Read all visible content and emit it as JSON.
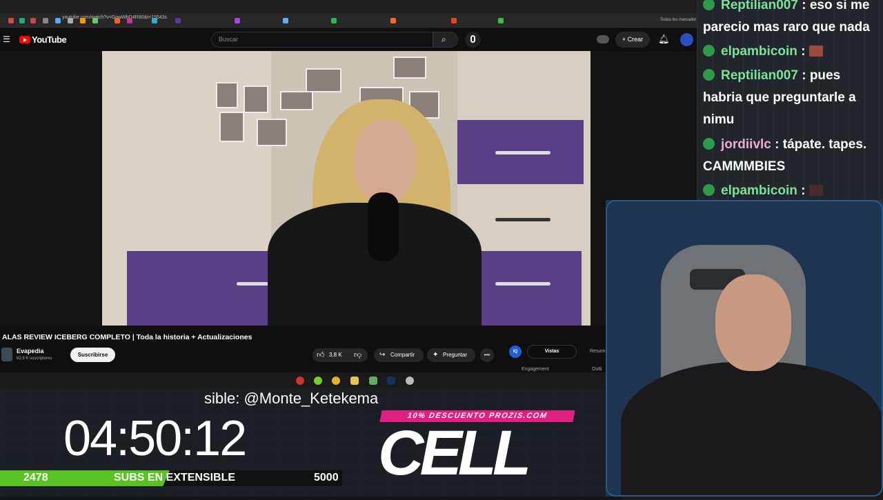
{
  "browser": {
    "url": "youtube.com/watch?v=GgwWbD4R80&t=15543s",
    "bookmarks_label": "Todos los marcador"
  },
  "youtube": {
    "logo_text": "YouTube",
    "search_placeholder": "Buscar",
    "create_label": "Crear",
    "video_title": "ALAS REVIEW ICEBERG COMPLETO | Toda la historia + Actualizaciones",
    "channel_name": "Evapedia",
    "channel_subs": "62,9 K suscriptores",
    "subscribe_label": "Suscribirse",
    "likes": "3,8 K",
    "share_label": "Compartir",
    "ask_label": "Preguntar",
    "side_tabs": {
      "iq": "IQ",
      "vistas": "Vistas",
      "resumen": "Resum",
      "engagement": "Engagement",
      "outline": "Outli"
    }
  },
  "overlay": {
    "ticker": "sible: @Monte_Ketekema",
    "timer": "04:50:12",
    "subs_current": "2478",
    "subs_label": "SUBS EN EXTENSIBLE",
    "subs_goal": "5000",
    "subs_progress": 0.4956,
    "promo": "10% DESCUENTO PROZIS.COM",
    "brand": "CELL"
  },
  "chat": {
    "messages": [
      {
        "user": "Reptilian007",
        "text": "eso si me parecio mas raro que nada",
        "color": "#7ae39a"
      },
      {
        "user": "elpambicoin",
        "text": "",
        "emote": true,
        "color": "#7ae39a"
      },
      {
        "user": "Reptilian007",
        "text": "pues habria que preguntarle a nimu",
        "color": "#7ae39a"
      },
      {
        "user": "jordiivlc",
        "text": "tápate. tapes. CAMMMBIES",
        "color": "#e8b0c9"
      },
      {
        "user": "elpambicoin",
        "text": "",
        "emote": true,
        "color": "#7ae39a"
      }
    ]
  }
}
